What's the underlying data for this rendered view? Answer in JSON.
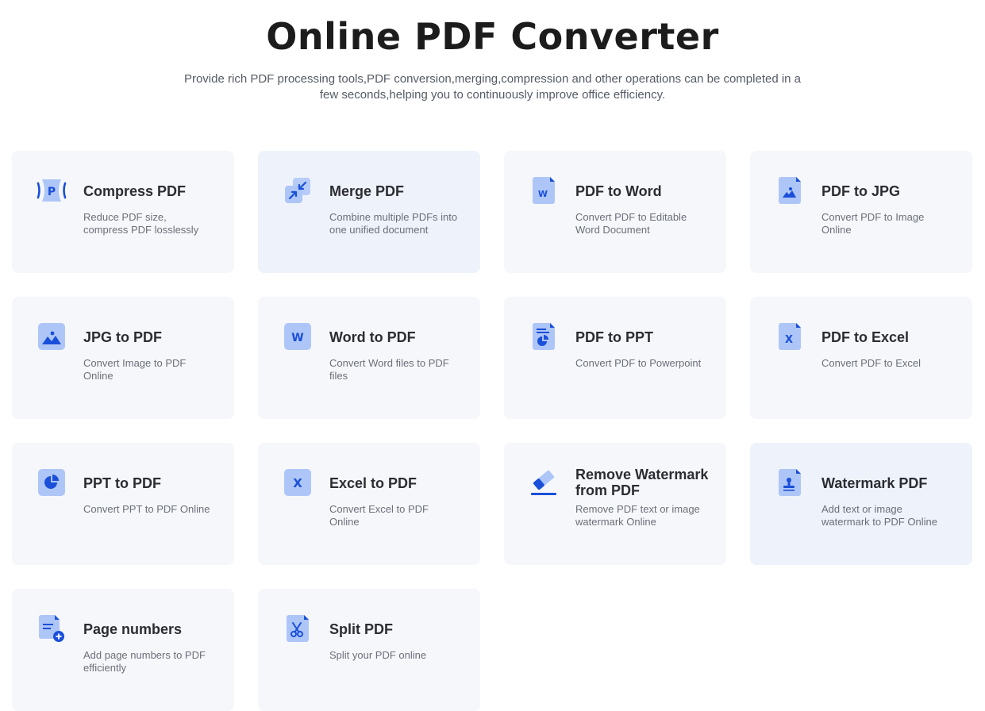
{
  "header": {
    "title": "Online PDF Converter",
    "subtitle": "Provide rich PDF processing tools,PDF conversion,merging,compression and other operations can be completed in a few seconds,helping you to continuously improve office efficiency."
  },
  "colors": {
    "accent": "#1a4fd9",
    "icon_light": "#aec6f7",
    "card_bg": "#f6f7fb",
    "card_bg_highlight": "#eef2fa"
  },
  "tools": [
    {
      "title": "Compress PDF",
      "desc": "Reduce PDF size, compress PDF losslessly",
      "icon": "compress-icon",
      "highlighted": false
    },
    {
      "title": "Merge PDF",
      "desc": "Combine multiple PDFs into one unified document",
      "icon": "merge-icon",
      "highlighted": true
    },
    {
      "title": "PDF to Word",
      "desc": "Convert PDF to Editable Word Document",
      "icon": "word-document-icon",
      "highlighted": false
    },
    {
      "title": "PDF to JPG",
      "desc": "Convert PDF to Image Online",
      "icon": "image-document-icon",
      "highlighted": false
    },
    {
      "title": "JPG to PDF",
      "desc": "Convert Image to PDF Online",
      "icon": "image-icon",
      "highlighted": false
    },
    {
      "title": "Word to PDF",
      "desc": "Convert Word files to PDF files",
      "icon": "word-icon",
      "highlighted": false
    },
    {
      "title": "PDF to PPT",
      "desc": "Convert PDF to Powerpoint",
      "icon": "ppt-document-icon",
      "highlighted": false
    },
    {
      "title": "PDF to Excel",
      "desc": "Convert PDF to Excel",
      "icon": "excel-document-icon",
      "highlighted": false
    },
    {
      "title": "PPT to PDF",
      "desc": "Convert PPT to PDF Online",
      "icon": "pie-chart-icon",
      "highlighted": false
    },
    {
      "title": "Excel to PDF",
      "desc": "Convert Excel to PDF Online",
      "icon": "excel-icon",
      "highlighted": false
    },
    {
      "title": "Remove Watermark from PDF",
      "desc": "Remove PDF text or image watermark Online",
      "icon": "eraser-icon",
      "highlighted": false
    },
    {
      "title": "Watermark PDF",
      "desc": "Add text or image watermark to PDF Online",
      "icon": "stamp-document-icon",
      "highlighted": true
    },
    {
      "title": "Page numbers",
      "desc": "Add page numbers to PDF efficiently",
      "icon": "page-number-icon",
      "highlighted": false
    },
    {
      "title": "Split PDF",
      "desc": "Split your PDF online",
      "icon": "scissors-document-icon",
      "highlighted": false
    }
  ]
}
